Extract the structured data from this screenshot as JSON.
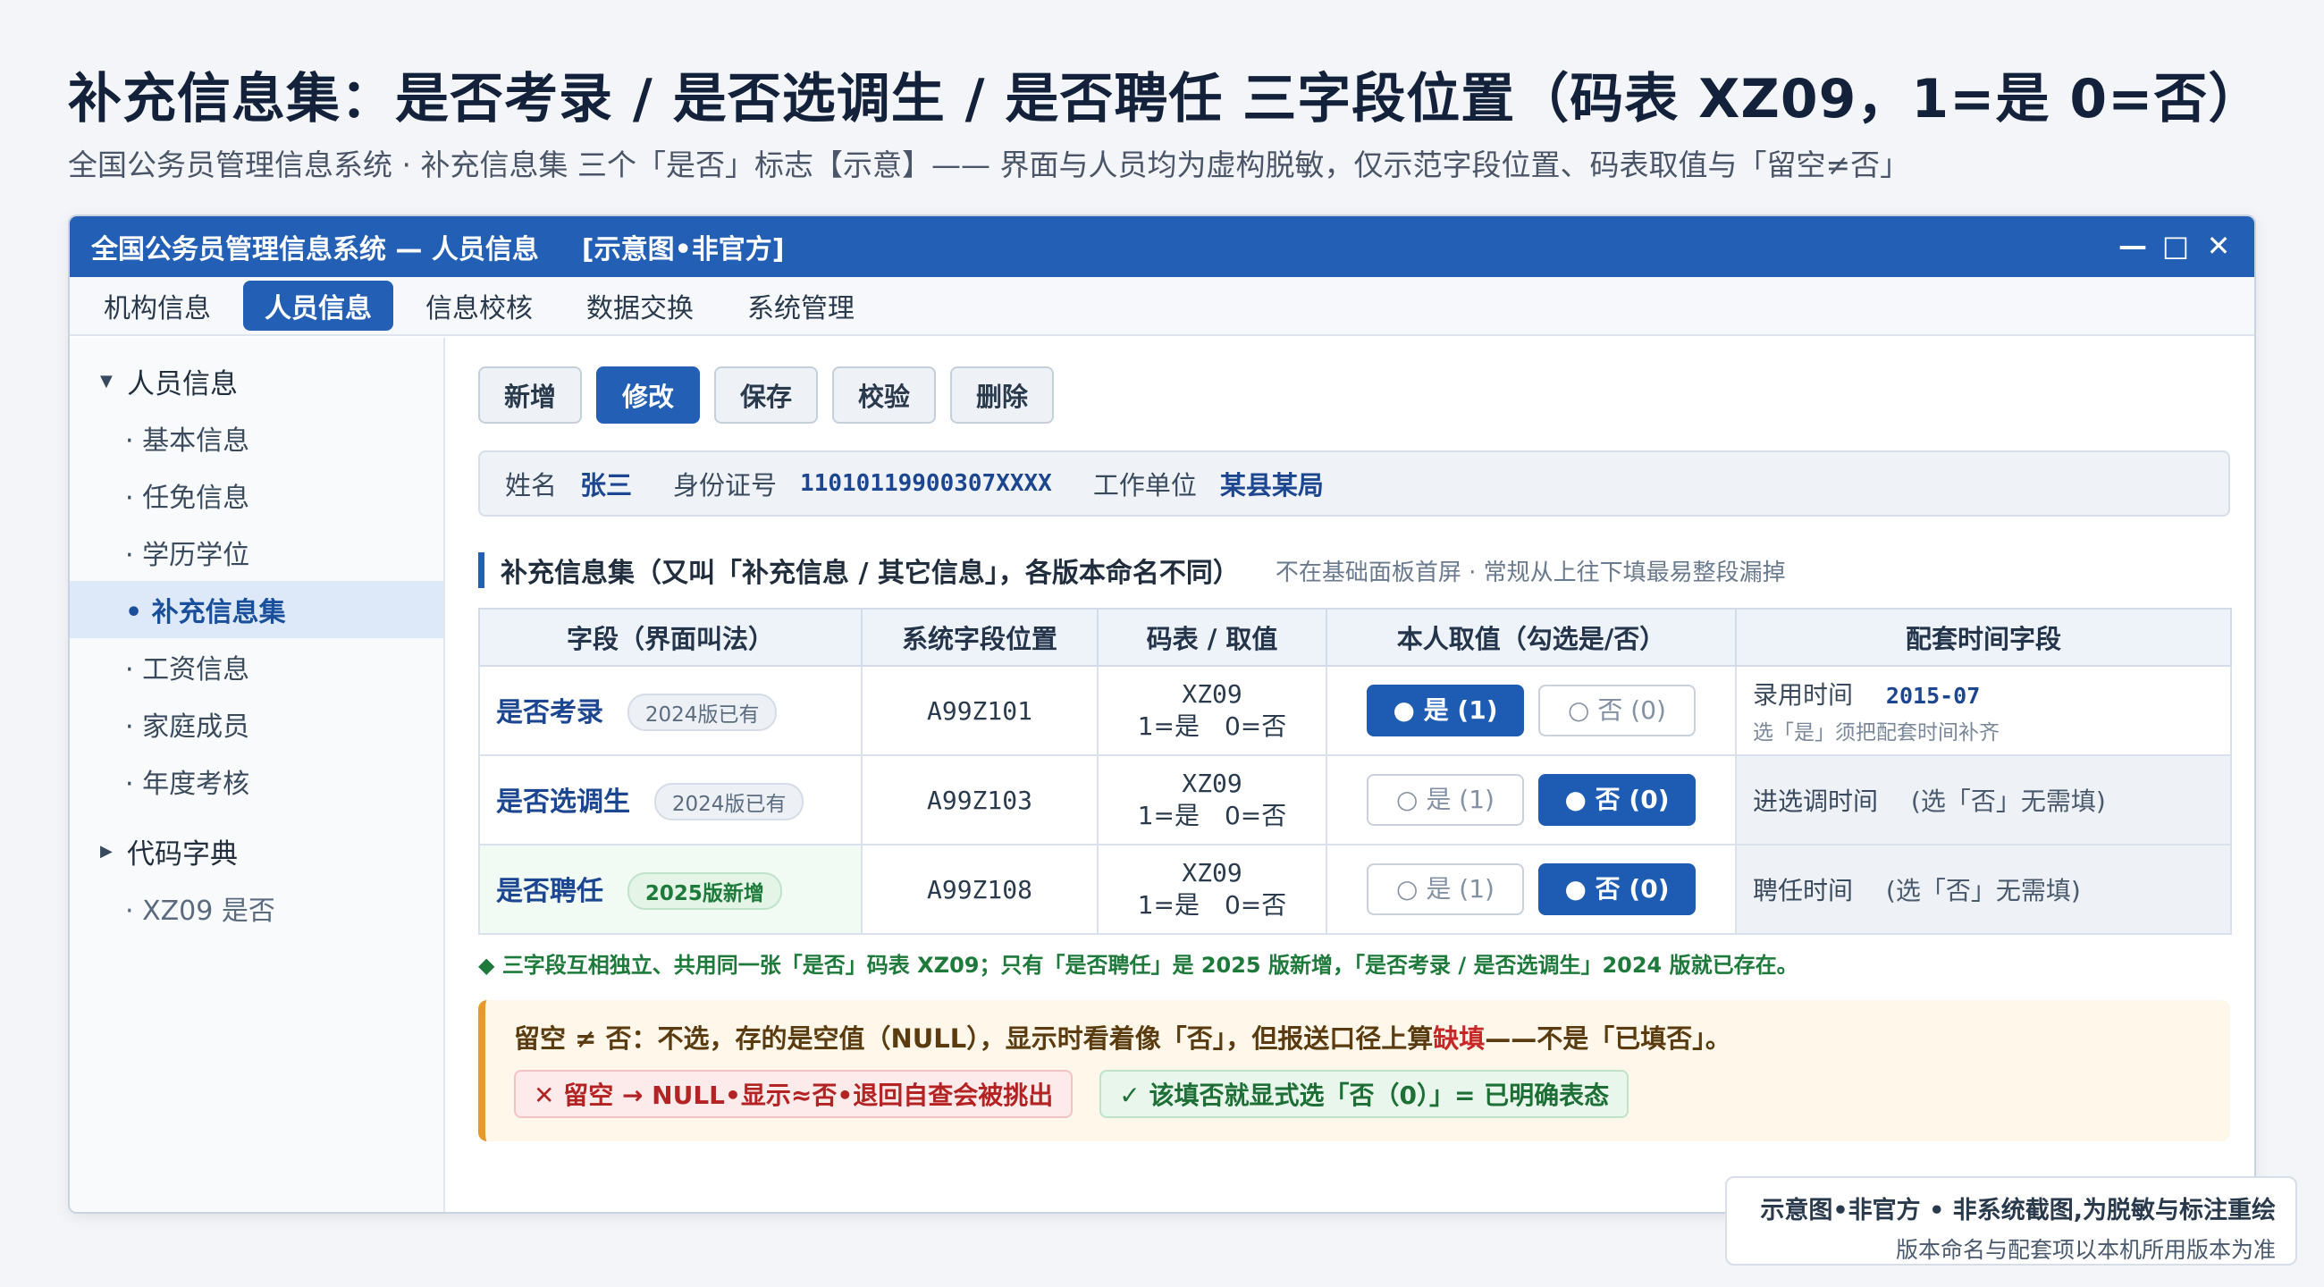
{
  "page": {
    "title": "补充信息集：是否考录 / 是否选调生 / 是否聘任 三字段位置（码表 XZ09，1=是 0=否）",
    "subtitle": "全国公务员管理信息系统 · 补充信息集 三个「是否」标志【示意】—— 界面与人员均为虚构脱敏，仅示范字段位置、码表取值与「留空≠否」"
  },
  "window": {
    "title": "全国公务员管理信息系统 — 人员信息",
    "tag": "[示意图•非官方]",
    "controls": {
      "minimize": "—",
      "maximize": "□",
      "close": "✕"
    }
  },
  "menu": {
    "items": [
      {
        "label": "机构信息",
        "active": false
      },
      {
        "label": "人员信息",
        "active": true
      },
      {
        "label": "信息校核",
        "active": false
      },
      {
        "label": "数据交换",
        "active": false
      },
      {
        "label": "系统管理",
        "active": false
      }
    ]
  },
  "sidebar": {
    "group1": {
      "caret": "▼",
      "label": "人员信息"
    },
    "items": [
      "· 基本信息",
      "· 任免信息",
      "· 学历学位",
      "• 补充信息集",
      "· 工资信息",
      "· 家庭成员",
      "· 年度考核"
    ],
    "active_index": 3,
    "group2": {
      "caret": "▶",
      "label": "代码字典"
    },
    "dict_item": "· XZ09 是否"
  },
  "toolbar": {
    "buttons": [
      {
        "label": "新增",
        "primary": false
      },
      {
        "label": "修改",
        "primary": true
      },
      {
        "label": "保存",
        "primary": false
      },
      {
        "label": "校验",
        "primary": false
      },
      {
        "label": "删除",
        "primary": false
      }
    ]
  },
  "person": {
    "name_label": "姓名",
    "name": "张三",
    "id_label": "身份证号",
    "id": "11010119900307XXXX",
    "unit_label": "工作单位",
    "unit": "某县某局"
  },
  "section": {
    "title": "补充信息集（又叫「补充信息 / 其它信息」，各版本命名不同）",
    "note": "不在基础面板首屏 · 常规从上往下填最易整段漏掉"
  },
  "table": {
    "headers": [
      "字段（界面叫法）",
      "系统字段位置",
      "码表 / 取值",
      "本人取值（勾选是/否）",
      "配套时间字段"
    ],
    "rows": [
      {
        "field": "是否考录",
        "badge": "2024版已有",
        "badge_new": false,
        "position": "A99Z101",
        "code": "XZ09",
        "code_values": "1=是　0=否",
        "yes_label": "● 是 (1)",
        "no_label": "○ 否 (0)",
        "selected": "yes",
        "time_label": "录用时间",
        "time_value": "2015-07",
        "time_hint": "选「是」须把配套时间补齐",
        "time_note": ""
      },
      {
        "field": "是否选调生",
        "badge": "2024版已有",
        "badge_new": false,
        "position": "A99Z103",
        "code": "XZ09",
        "code_values": "1=是　0=否",
        "yes_label": "○ 是 (1)",
        "no_label": "● 否 (0)",
        "selected": "no",
        "time_label": "进选调时间",
        "time_value": "",
        "time_hint": "",
        "time_note": "(选「否」无需填)"
      },
      {
        "field": "是否聘任",
        "badge": "2025版新增",
        "badge_new": true,
        "position": "A99Z108",
        "code": "XZ09",
        "code_values": "1=是　0=否",
        "yes_label": "○ 是 (1)",
        "no_label": "● 否 (0)",
        "selected": "no",
        "time_label": "聘任时间",
        "time_value": "",
        "time_hint": "",
        "time_note": "(选「否」无需填)"
      }
    ]
  },
  "green_note": "◆ 三字段互相独立、共用同一张「是否」码表 XZ09；只有「是否聘任」是 2025 版新增，「是否考录 / 是否选调生」2024 版就已存在。",
  "callout": {
    "text_before": "留空 ≠ 否：不选，存的是空值（NULL），显示时看着像「否」，但报送口径上算",
    "text_red": "缺填",
    "text_after": "——不是「已填否」。",
    "bad_tag": "✕ 留空 → NULL•显示≈否•退回自查会被挑出",
    "good_tag": "✓ 该填否就显式选「否（0）」= 已明确表态"
  },
  "disclaimer": {
    "line1": "示意图•非官方 • 非系统截图,为脱敏与标注重绘",
    "line2": "版本命名与配套项以本机所用版本为准"
  },
  "colors": {
    "primary": "#2360b5",
    "accent_orange": "#e59a2a",
    "success": "#1d7a3a",
    "danger": "#c62828"
  }
}
